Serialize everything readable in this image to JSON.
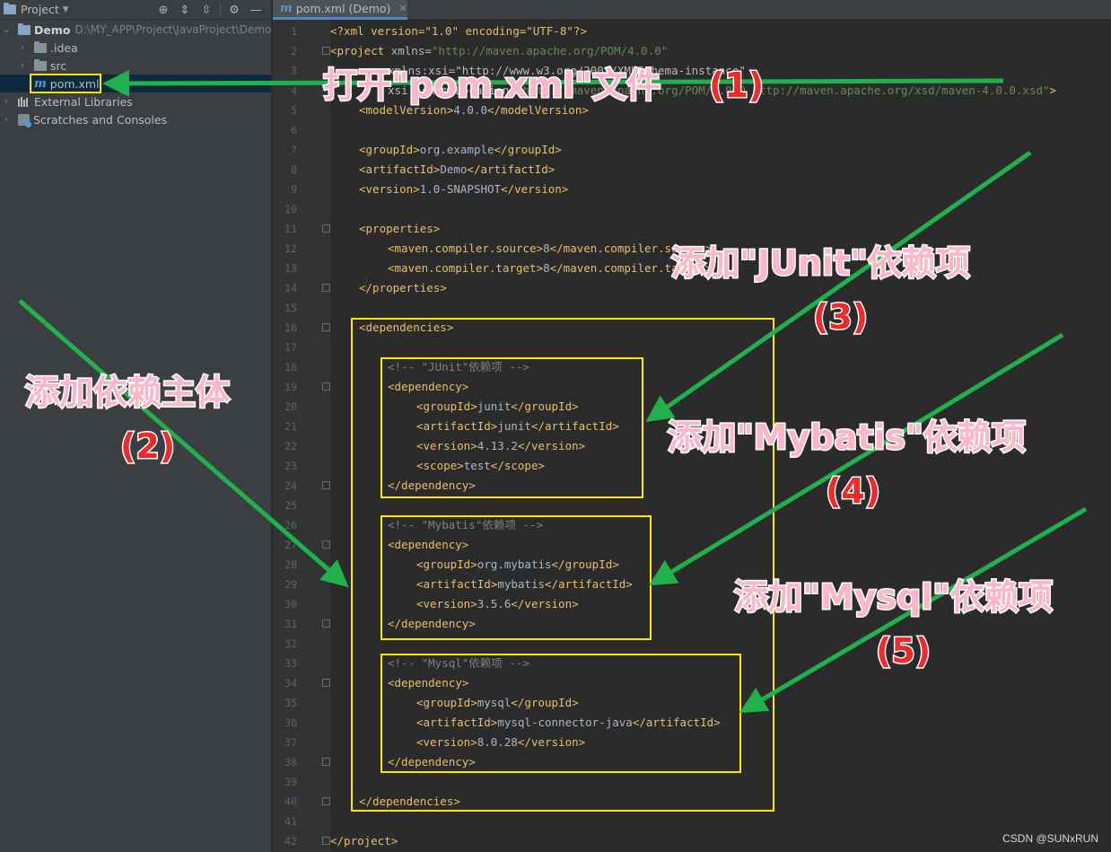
{
  "project_panel": {
    "title": "Project",
    "tree": {
      "root_name": "Demo",
      "root_path": "D:\\MY_APP\\Project\\JavaProject\\Demo",
      "idea": ".idea",
      "src": "src",
      "pom": "pom.xml",
      "external_libraries": "External Libraries",
      "scratches": "Scratches and Consoles"
    }
  },
  "editor": {
    "tab_label": "pom.xml (Demo)",
    "line_numbers": [
      "1",
      "2",
      "3",
      "4",
      "5",
      "6",
      "7",
      "8",
      "9",
      "10",
      "11",
      "12",
      "13",
      "14",
      "15",
      "16",
      "17",
      "18",
      "19",
      "20",
      "21",
      "22",
      "23",
      "24",
      "25",
      "26",
      "27",
      "28",
      "29",
      "30",
      "31",
      "32",
      "33",
      "34",
      "35",
      "36",
      "37",
      "38",
      "39",
      "40",
      "41",
      "42"
    ],
    "lines": {
      "l1_decl": "<?xml version=\"1.0\" encoding=\"UTF-8\"?>",
      "l2_project": "<project ",
      "l2_attr": "xmlns=",
      "l2_val": "\"http://maven.apache.org/POM/4.0.0\"",
      "l3": "xmlns:xsi=\"http://www.w3.org/2001/XMLSchema-instance\"",
      "l4_attr": "xsi:schemaLocation=",
      "l4_val": "\"http://maven.apache.org/POM/4.0.0 http://maven.apache.org/xsd/maven-4.0.0.xsd\"",
      "l4_close": ">",
      "model_open": "<modelVersion>",
      "model_val": "4.0.0",
      "model_close": "</modelVersion>",
      "group_open": "<groupId>",
      "group_close": "</groupId>",
      "group_val": "org.example",
      "artifact_open": "<artifactId>",
      "artifact_close": "</artifactId>",
      "artifact_val": "Demo",
      "version_open": "<version>",
      "version_close": "</version>",
      "version_val": "1.0-SNAPSHOT",
      "props_open": "<properties>",
      "source_open": "<maven.compiler.source>",
      "source_val": "8",
      "source_close": "</maven.compiler.source>",
      "target_open": "<maven.compiler.target>",
      "target_val": "8",
      "target_close": "</maven.compiler.target>",
      "props_close": "</properties>",
      "deps_open": "<dependencies>",
      "junit_comment": "<!-- \"JUnit\"依赖项 -->",
      "dep_open": "<dependency>",
      "dep_close": "</dependency>",
      "junit_group": "junit",
      "junit_artifact": "junit",
      "junit_version": "4.13.2",
      "scope_open": "<scope>",
      "scope_val": "test",
      "scope_close": "</scope>",
      "mybatis_comment": "<!-- \"Mybatis\"依赖项 -->",
      "mybatis_group": "org.mybatis",
      "mybatis_artifact": "mybatis",
      "mybatis_version": "3.5.6",
      "mysql_comment": "<!-- \"Mysql\"依赖项 -->",
      "mysql_group": "mysql",
      "mysql_artifact": "mysql-connector-java",
      "mysql_version": "8.0.28",
      "deps_close": "</dependencies>",
      "project_close": "</project>"
    }
  },
  "annotations": {
    "open_pom": "打开\"pom.xml\"文件",
    "open_pom_num": "(1)",
    "add_body": "添加依赖主体",
    "add_body_num": "(2)",
    "add_junit": "添加\"JUnit\"依赖项",
    "add_junit_num": "(3)",
    "add_mybatis": "添加\"Mybatis\"依赖项",
    "add_mybatis_num": "(4)",
    "add_mysql": "添加\"Mysql\"依赖项",
    "add_mysql_num": "(5)"
  },
  "colors": {
    "highlight_box": "#ffe600",
    "arrow": "#21b14c",
    "annotation_text": "#ffb6c8",
    "annotation_number": "#f02a2a"
  },
  "watermark": "CSDN @SUNxRUN"
}
